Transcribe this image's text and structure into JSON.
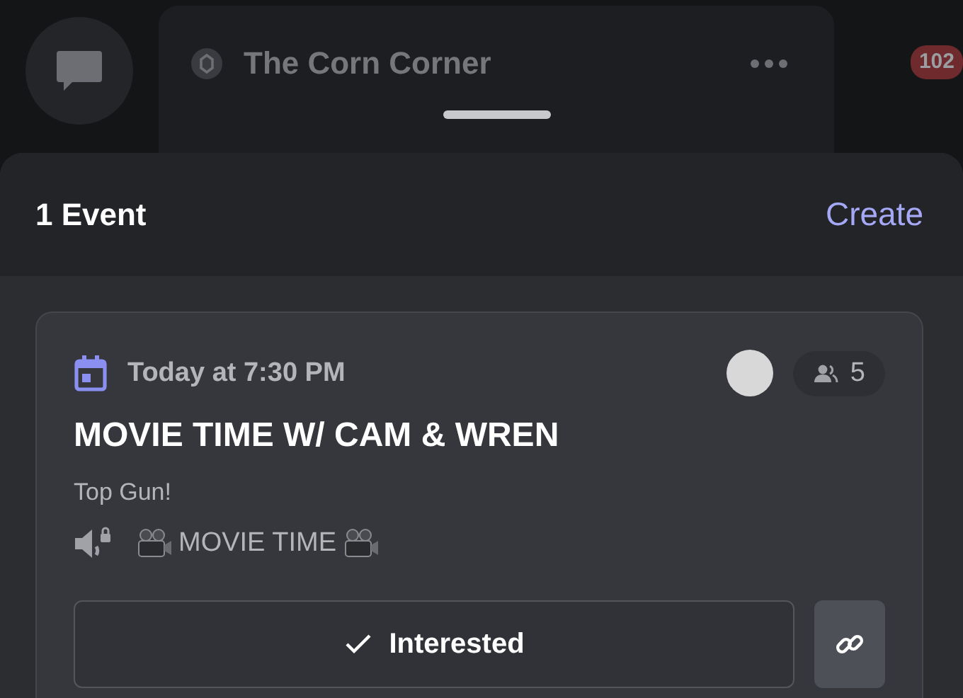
{
  "background_server": {
    "name": "The Corn Corner",
    "unread_badge": "102"
  },
  "sheet": {
    "title": "1 Event",
    "create_label": "Create"
  },
  "event": {
    "time": "Today at 7:30 PM",
    "interested_count": "5",
    "title": "MOVIE TIME W/ CAM & WREN",
    "description": "Top Gun!",
    "channel": "MOVIE TIME",
    "interested_label": "Interested",
    "interested": true
  }
}
